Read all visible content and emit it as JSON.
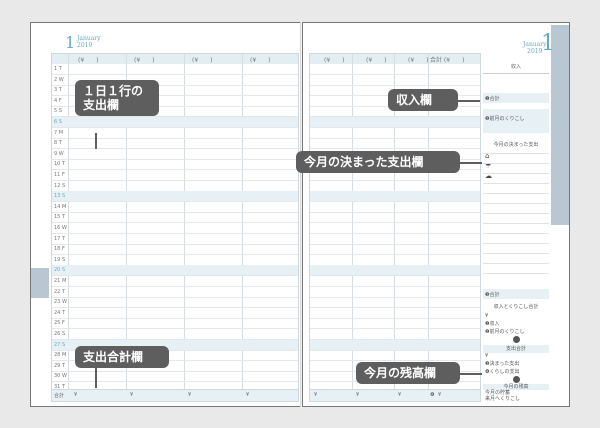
{
  "month": {
    "number": "1",
    "name": "January",
    "year": "2019"
  },
  "left_page": {
    "column_header": [
      "(¥　　)",
      "(¥　　)",
      "(¥　　)",
      "(¥　　)"
    ],
    "days": [
      {
        "d": "1 T",
        "sun": false
      },
      {
        "d": "2 W",
        "sun": false
      },
      {
        "d": "3 T",
        "sun": false
      },
      {
        "d": "4 F",
        "sun": false
      },
      {
        "d": "5 S",
        "sun": false
      },
      {
        "d": "6 S",
        "sun": true
      },
      {
        "d": "7 M",
        "sun": false
      },
      {
        "d": "8 T",
        "sun": false
      },
      {
        "d": "9 W",
        "sun": false
      },
      {
        "d": "10 T",
        "sun": false
      },
      {
        "d": "11 F",
        "sun": false
      },
      {
        "d": "12 S",
        "sun": false
      },
      {
        "d": "13 S",
        "sun": true
      },
      {
        "d": "14 M",
        "sun": false
      },
      {
        "d": "15 T",
        "sun": false
      },
      {
        "d": "16 W",
        "sun": false
      },
      {
        "d": "17 T",
        "sun": false
      },
      {
        "d": "18 F",
        "sun": false
      },
      {
        "d": "19 S",
        "sun": false
      },
      {
        "d": "20 S",
        "sun": true
      },
      {
        "d": "21 M",
        "sun": false
      },
      {
        "d": "22 T",
        "sun": false
      },
      {
        "d": "23 W",
        "sun": false
      },
      {
        "d": "24 T",
        "sun": false
      },
      {
        "d": "25 F",
        "sun": false
      },
      {
        "d": "26 S",
        "sun": false
      },
      {
        "d": "27 S",
        "sun": true
      },
      {
        "d": "28 M",
        "sun": false
      },
      {
        "d": "29 T",
        "sun": false
      },
      {
        "d": "30 W",
        "sun": false
      },
      {
        "d": "31 T",
        "sun": false
      }
    ],
    "total_label": "合計",
    "total_yen": "¥"
  },
  "right_page": {
    "column_header": [
      "(¥　　)",
      "(¥　　)",
      "(¥　　)",
      "合計 (¥　　)"
    ],
    "total_yen": "¥",
    "sidebar": {
      "income_title": "収入",
      "income_total": "❶合計",
      "prev_balance": "❷前月のくりこし",
      "fixed_title": "今月の決まった支出",
      "sum3": "❸合計",
      "combined_title": "収入とくりこし合計",
      "yen1": "¥",
      "line1": "❶収入",
      "line2": "❷前月のくりこし",
      "expense_title": "支出合計",
      "yen2": "¥",
      "line3": "❸決まった支出",
      "line4": "❹くらしの支出",
      "balance_title": "今月の残高",
      "yen3": "¥",
      "line5": "今月の貯蓄",
      "line6": "来月へくりこし"
    }
  },
  "callouts": {
    "daily_expense": "１日１行の\n支出欄",
    "expense_total": "支出合計欄",
    "income": "収入欄",
    "fixed_expense": "今月の決まった支出欄",
    "balance": "今月の残高欄"
  }
}
